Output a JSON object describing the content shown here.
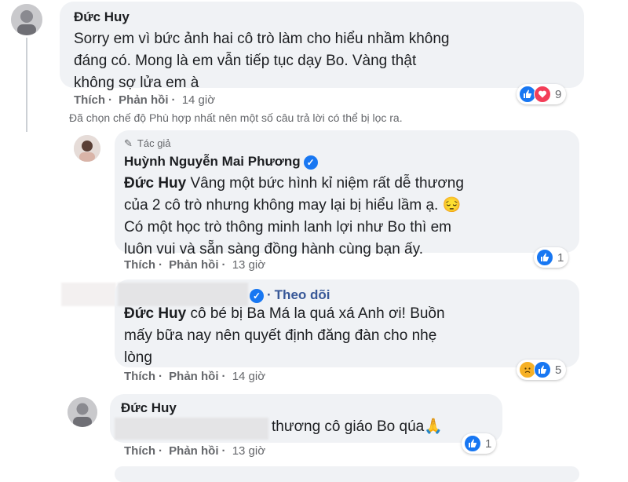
{
  "comments": [
    {
      "author": "Đức Huy",
      "lines": [
        "Sorry em vì bức ảnh hai cô trò làm cho hiểu nhầm không",
        "đáng có. Mong là em vẫn tiếp tục dạy Bo. Vàng thật",
        "không sợ lửa em à"
      ],
      "like_label": "Thích",
      "reply_label": "Phản hồi",
      "time": "14 giờ",
      "reaction_count": "9"
    },
    {
      "badge": "Tác giả",
      "author": "Huỳnh Nguyễn Mai Phương",
      "mention": "Đức Huy",
      "first_line_rest": " Vâng một bức hình kỉ niệm rất dễ thương",
      "lines": [
        "của 2 cô trò nhưng không may lại bị hiểu lầm ạ. 😔",
        "Có một học trò thông minh lanh lợi như Bo thì em",
        "luôn vui và sẵn sàng đồng hành cùng bạn ấy."
      ],
      "like_label": "Thích",
      "reply_label": "Phản hồi",
      "time": "13 giờ",
      "reaction_count": "1"
    },
    {
      "follow_label": "Theo dõi",
      "mention": "Đức Huy",
      "first_line_rest": " cô bé bị Ba Má la quá xá Anh ơi! Buồn",
      "lines": [
        "mấy bữa nay nên quyết định đăng đàn cho nhẹ",
        "lòng"
      ],
      "like_label": "Thích",
      "reply_label": "Phản hồi",
      "time": "14 giờ",
      "reaction_count": "5"
    },
    {
      "author": "Đức Huy",
      "text": "thương cô giáo Bo qúa🙏",
      "like_label": "Thích",
      "reply_label": "Phản hồi",
      "time": "13 giờ",
      "reaction_count": "1"
    }
  ],
  "filter_note": "Đã chọn chế độ Phù hợp nhất nên một số câu trả lời có thể bị lọc ra.",
  "separator": "·",
  "colors": {
    "like_blue": "#1877f2",
    "love_red": "#f33e58",
    "sad_yellow": "#f7b125",
    "bubble": "#f0f2f5"
  }
}
